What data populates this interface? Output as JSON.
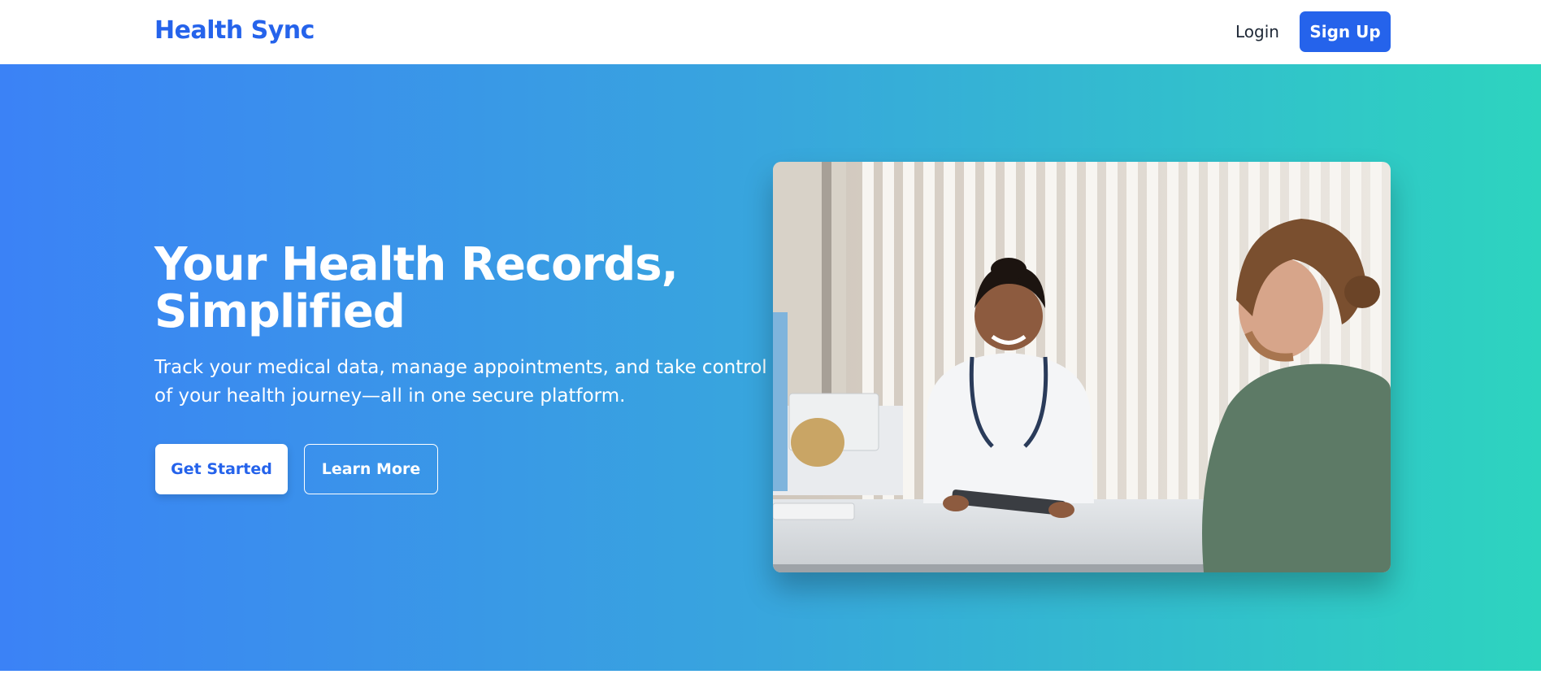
{
  "nav": {
    "brand": "Health Sync",
    "login_label": "Login",
    "signup_label": "Sign Up"
  },
  "hero": {
    "title": "Your Health Records, Simplified",
    "subtitle": "Track your medical data, manage appointments, and take control of your health journey—all in one secure platform.",
    "primary_button": "Get Started",
    "secondary_button": "Learn More"
  },
  "colors": {
    "brand": "#2563eb",
    "gradient_start": "#3b82f6",
    "gradient_end": "#2dd4bf"
  }
}
